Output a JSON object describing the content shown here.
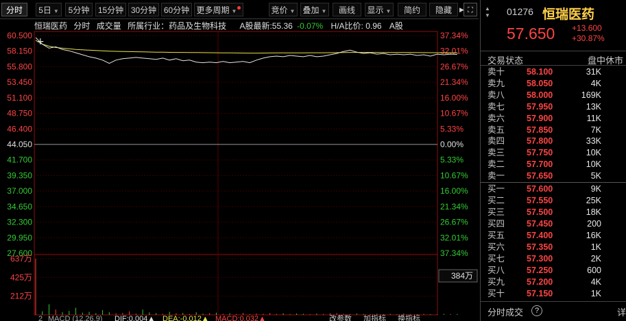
{
  "toolbar": {
    "tabs": [
      "分时",
      "5日",
      "5分钟",
      "15分钟",
      "30分钟",
      "60分钟",
      "更多周期"
    ],
    "actions": [
      "竞价",
      "叠加",
      "画线",
      "显示",
      "简约",
      "隐藏"
    ]
  },
  "chart_header": {
    "name": "恒瑞医药",
    "mode": "分时",
    "volume_label": "成交量",
    "industry": "所属行业：药品及生物科技",
    "a_share": "A股最新:55.36",
    "a_change": "-0.07%",
    "ha_ratio": "H/A比价: 0.96",
    "a_link": "A股"
  },
  "price_axis": {
    "left": [
      "60.500",
      "58.150",
      "55.800",
      "53.450",
      "51.100",
      "48.750",
      "46.400",
      "44.050",
      "41.700",
      "39.350",
      "37.000",
      "34.650",
      "32.300",
      "29.950",
      "27.600"
    ],
    "right": [
      "37.34%",
      "32.01%",
      "26.67%",
      "21.34%",
      "16.00%",
      "10.67%",
      "5.33%",
      "0.00%",
      "5.33%",
      "10.67%",
      "16.00%",
      "21.34%",
      "26.67%",
      "32.01%",
      "37.34%"
    ]
  },
  "volume_axis": {
    "labels": [
      "637万",
      "425万",
      "212万"
    ],
    "right_box": "384万"
  },
  "indicator_bar": {
    "num": "2",
    "macd": "MACD (12,26,9)",
    "dif": "DIF:0.004▲",
    "dea": "DEA:-0.012▲",
    "macd_val": "MACD:0.032▲",
    "btn1": "改参数",
    "btn2": "加指标",
    "btn3": "换指标"
  },
  "chart_data": {
    "type": "line",
    "prev_close": 44.05,
    "ylim": [
      27.6,
      60.5
    ],
    "series": [
      {
        "role": "price",
        "color": "#e6e6e6",
        "values": [
          60.2,
          59.2,
          58.6,
          58.8,
          58.4,
          58.2,
          57.9,
          57.6,
          57.3,
          57.1,
          56.8,
          56.3,
          56.8,
          57.0,
          57.1,
          57.2,
          57.1,
          57.0,
          56.9,
          57.1,
          56.8,
          57.0,
          56.7,
          56.8,
          56.5,
          56.4,
          56.5,
          56.4,
          56.6,
          56.4,
          56.5,
          56.6,
          56.4,
          56.8,
          57.1,
          57.3,
          57.4,
          57.3,
          57.5,
          57.4,
          57.3,
          57.5,
          57.3,
          57.4,
          57.6,
          57.8,
          58.1,
          58.3,
          58.0,
          57.8,
          57.9,
          57.7,
          57.8,
          57.6,
          57.7,
          57.6,
          57.7,
          57.5,
          57.6,
          57.4,
          57.7,
          57.6,
          57.7,
          57.65
        ]
      },
      {
        "role": "average",
        "color": "#e4e64a",
        "values": [
          59.8,
          59.2,
          58.9,
          58.7,
          58.6,
          58.5,
          58.4,
          58.35,
          58.3,
          58.25,
          58.2,
          58.15,
          58.12,
          58.1,
          58.08,
          58.06,
          58.04,
          58.02,
          58.0,
          57.99,
          57.97,
          57.96,
          57.95,
          57.94,
          57.93,
          57.92,
          57.91,
          57.9,
          57.89,
          57.88,
          57.87,
          57.86,
          57.85,
          57.85,
          57.86,
          57.87,
          57.88,
          57.88,
          57.89,
          57.89,
          57.89,
          57.9,
          57.9,
          57.9,
          57.91,
          57.92,
          57.93,
          57.95,
          57.95,
          57.95,
          57.95,
          57.95,
          57.94,
          57.94,
          57.94,
          57.93,
          57.93,
          57.92,
          57.92,
          57.91,
          57.91,
          57.91,
          57.9,
          57.9
        ]
      }
    ],
    "volume": [
      637,
      40,
      120,
      60,
      30,
      45,
      80,
      25,
      35,
      20,
      55,
      30,
      18,
      22,
      40,
      15,
      60,
      28,
      20,
      12,
      35,
      18,
      22,
      10,
      30,
      14,
      20,
      25,
      12,
      18,
      10,
      22,
      8,
      15,
      12,
      20,
      10,
      18,
      9,
      16,
      12,
      8,
      14,
      10,
      18,
      20,
      12,
      9,
      15,
      10,
      8,
      12,
      7,
      10,
      8,
      14,
      9,
      6,
      11,
      8,
      7,
      12,
      9,
      10
    ],
    "volume_unit": "万",
    "volume_ylim": [
      0,
      637
    ]
  },
  "quote": {
    "code": "01276",
    "name": "恒瑞医药",
    "price": "57.650",
    "change": "+13.600",
    "change_pct": "+30.87%",
    "state_label": "交易状态",
    "state_value": "盘中休市",
    "asks": [
      {
        "label": "卖十",
        "price": "58.100",
        "vol": "31K"
      },
      {
        "label": "卖九",
        "price": "58.050",
        "vol": "4K"
      },
      {
        "label": "卖八",
        "price": "58.000",
        "vol": "169K"
      },
      {
        "label": "卖七",
        "price": "57.950",
        "vol": "13K"
      },
      {
        "label": "卖六",
        "price": "57.900",
        "vol": "11K"
      },
      {
        "label": "卖五",
        "price": "57.850",
        "vol": "7K"
      },
      {
        "label": "卖四",
        "price": "57.800",
        "vol": "33K"
      },
      {
        "label": "卖三",
        "price": "57.750",
        "vol": "10K"
      },
      {
        "label": "卖二",
        "price": "57.700",
        "vol": "10K"
      },
      {
        "label": "卖一",
        "price": "57.650",
        "vol": "5K"
      }
    ],
    "bids": [
      {
        "label": "买一",
        "price": "57.600",
        "vol": "9K"
      },
      {
        "label": "买二",
        "price": "57.550",
        "vol": "25K"
      },
      {
        "label": "买三",
        "price": "57.500",
        "vol": "18K"
      },
      {
        "label": "买四",
        "price": "57.450",
        "vol": "200"
      },
      {
        "label": "买五",
        "price": "57.400",
        "vol": "16K"
      },
      {
        "label": "买六",
        "price": "57.350",
        "vol": "1K"
      },
      {
        "label": "买七",
        "price": "57.300",
        "vol": "2K"
      },
      {
        "label": "买八",
        "price": "57.250",
        "vol": "600"
      },
      {
        "label": "买九",
        "price": "57.200",
        "vol": "4K"
      },
      {
        "label": "买十",
        "price": "57.150",
        "vol": "1K"
      }
    ],
    "detail_label": "分时成交",
    "detail_help": "?",
    "detail_more": "详"
  },
  "colors": {
    "up": "#ff4444",
    "down": "#33cc33",
    "grid": "#3a0000",
    "axis": "#8a1010"
  }
}
